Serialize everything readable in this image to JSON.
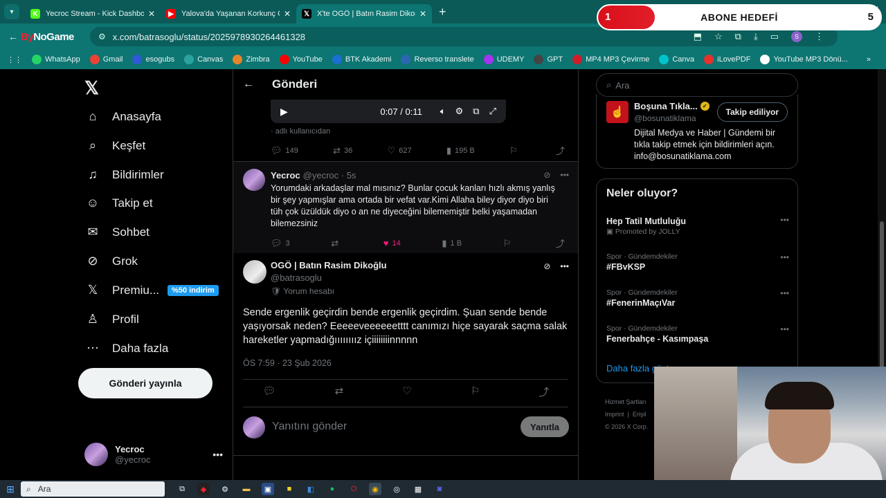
{
  "browser": {
    "tabs": [
      {
        "title": "Yecroc Stream - Kick Dashboard",
        "icon": "kick-icon",
        "color": "#53fc18",
        "glyph": "K"
      },
      {
        "title": "Yalova'da Yaşanan Korkunç Olay",
        "icon": "youtube-icon",
        "color": "#ff0000",
        "glyph": "▶"
      },
      {
        "title": "X'te OGÖ | Batın Rasim Dikoğlu",
        "icon": "x-icon",
        "color": "#000000",
        "glyph": "𝕏"
      }
    ],
    "url": "x.com/batrasoglu/status/2025978930264461328",
    "profile_initial": "S",
    "bookmarks": [
      {
        "label": "WhatsApp",
        "color": "#25d366"
      },
      {
        "label": "Gmail",
        "color": "#ea4335"
      },
      {
        "label": "esogubs",
        "color": "#2d5bd6"
      },
      {
        "label": "Canvas",
        "color": "#2aa3a0"
      },
      {
        "label": "Zimbra",
        "color": "#e5852a"
      },
      {
        "label": "YouTube",
        "color": "#ff0000"
      },
      {
        "label": "BTK Akademi",
        "color": "#1a6fd0"
      },
      {
        "label": "Reverso translete",
        "color": "#2b67b1"
      },
      {
        "label": "UDEMY",
        "color": "#a435f0"
      },
      {
        "label": "GPT",
        "color": "#444444"
      },
      {
        "label": "MP4 MP3 Çevirme",
        "color": "#d11d2a"
      },
      {
        "label": "Canva",
        "color": "#00c4cc"
      },
      {
        "label": "iLovePDF",
        "color": "#e5322d"
      },
      {
        "label": "YouTube MP3 Dönü...",
        "color": "#ffffff"
      }
    ]
  },
  "overlay": {
    "current": "1",
    "label": "ABONE HEDEFİ",
    "target": "5",
    "progress": 0.2
  },
  "logo_watermark": {
    "text_a": "By",
    "text_b": "NoGame"
  },
  "nav": {
    "items": [
      {
        "label": "Anasayfa",
        "icon": "home-icon",
        "glyph": "⌂"
      },
      {
        "label": "Keşfet",
        "icon": "search-icon",
        "glyph": "⌕"
      },
      {
        "label": "Bildirimler",
        "icon": "bell-icon",
        "glyph": "♫"
      },
      {
        "label": "Takip et",
        "icon": "follow-icon",
        "glyph": "☺"
      },
      {
        "label": "Sohbet",
        "icon": "mail-icon",
        "glyph": "✉"
      },
      {
        "label": "Grok",
        "icon": "grok-icon",
        "glyph": "⊘"
      },
      {
        "label": "Premiu...",
        "icon": "x-premium-icon",
        "glyph": "𝕏"
      },
      {
        "label": "Profil",
        "icon": "profile-icon",
        "glyph": "♙"
      },
      {
        "label": "Daha fazla",
        "icon": "more-icon",
        "glyph": "⋯"
      }
    ],
    "premium_badge": "%50 indirim",
    "post_button": "Gönderi yayınla",
    "account": {
      "name": "Yecroc",
      "handle": "@yecroc"
    }
  },
  "main": {
    "title": "Gönderi",
    "video": {
      "time": "0:07 / 0:11"
    },
    "source_note": "· adlı kullanıcıdan",
    "top_stats": {
      "replies": "149",
      "reposts": "36",
      "likes": "627",
      "views": "195 B"
    },
    "reply": {
      "name": "Yecroc",
      "handle": "@yecroc · 5s",
      "text": "Yorumdaki arkadaşlar mal mısınız? Bunlar çocuk kanları hızlı akmış yanlış bir şey yapmışlar ama ortada bir vefat var.Kimi Allaha biley diyor diyo biri tüh çok üzüldük diyo o an ne diyeceğini bilememiştir belki yaşamadan bilemezsiniz",
      "stats": {
        "replies": "3",
        "likes": "14",
        "views": "1 B"
      }
    },
    "focus": {
      "name": "OGÖ | Batın Rasim Dikoğlu",
      "handle": "@batrasoglu",
      "badge": "Yorum hesabı",
      "text": "Sende ergenlik geçirdin bende ergenlik geçirdim. Şuan sende bende yaşıyorsak neden? Eeeeeveeeeeetttt canımızı hiçe sayarak saçma salak hareketler yapmadığıııııııız içiiiiiiiinnnnn",
      "date": "ÖS 7:59 · 23 Şub 2026"
    },
    "compose": {
      "placeholder": "Yanıtını gönder",
      "button": "Yanıtla"
    }
  },
  "right": {
    "search_placeholder": "Ara",
    "follow_card": {
      "name": "Boşuna Tıkla...",
      "handle": "@bosunatiklama",
      "button": "Takip ediliyor",
      "bio": "Dijital Medya ve Haber | Gündemi bir tıkla takip etmek için bildirimleri açın. info@bosunatiklama.com"
    },
    "trends_title": "Neler oluyor?",
    "trends": [
      {
        "category": "",
        "name": "Hep Tatil Mutluluğu",
        "promo": "Promoted by JOLLY"
      },
      {
        "category": "Spor · Gündemdekiler",
        "name": "#FBvKSP",
        "promo": ""
      },
      {
        "category": "Spor · Gündemdekiler",
        "name": "#FenerinMaçıVar",
        "promo": ""
      },
      {
        "category": "Spor · Gündemdekiler",
        "name": "Fenerbahçe - Kasımpaşa",
        "promo": ""
      }
    ],
    "more": "Daha fazla göster",
    "footer": {
      "l1": "Hizmet Şartları",
      "l2a": "Imprint",
      "l2b": "Erişil",
      "l3": "© 2026 X Corp."
    }
  },
  "taskbar": {
    "search": "Ara"
  }
}
